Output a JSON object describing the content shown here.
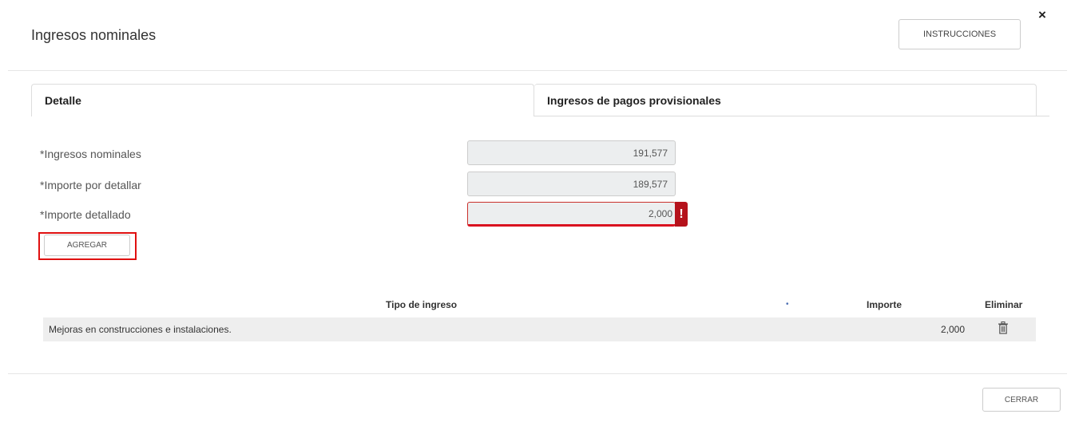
{
  "modal": {
    "title": "Ingresos nominales",
    "close_icon": "×",
    "instructions_label": "INSTRUCCIONES"
  },
  "tabs": [
    {
      "label": "Detalle",
      "active": true
    },
    {
      "label": "Ingresos de pagos provisionales",
      "active": false
    }
  ],
  "fields": {
    "ingresos_nominales": {
      "label": "*Ingresos nominales",
      "value": "191,577"
    },
    "importe_por_detallar": {
      "label": "*Importe por detallar",
      "value": "189,577"
    },
    "importe_detallado": {
      "label": "*Importe detallado",
      "value": "2,000",
      "error_icon": "!"
    }
  },
  "add_button_label": "AGREGAR",
  "table": {
    "headers": {
      "tipo": "Tipo de ingreso",
      "importe": "Importe",
      "eliminar": "Eliminar"
    },
    "rows": [
      {
        "tipo": "Mejoras en construcciones e instalaciones.",
        "importe": "2,000",
        "delete_icon": "trash-icon"
      }
    ]
  },
  "footer": {
    "close_label": "CERRAR"
  },
  "colors": {
    "error": "#b5121b",
    "highlight": "#e01010",
    "input_bg": "#eceeef"
  }
}
